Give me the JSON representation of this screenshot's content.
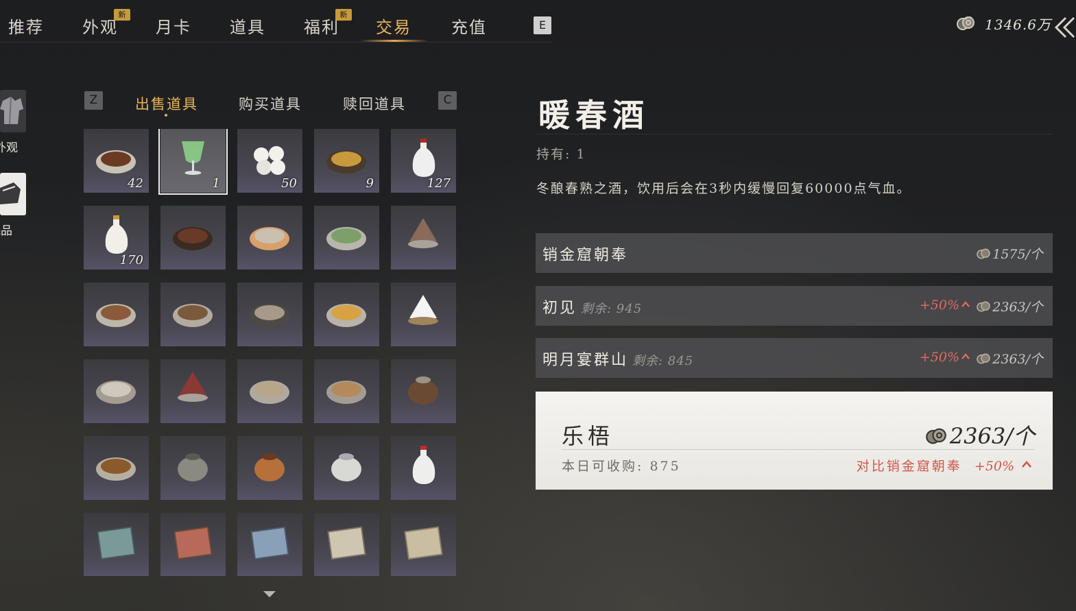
{
  "nav": {
    "tabs": [
      {
        "label": "推荐",
        "badge": ""
      },
      {
        "label": "外观",
        "badge": "新"
      },
      {
        "label": "月卡",
        "badge": ""
      },
      {
        "label": "道具",
        "badge": ""
      },
      {
        "label": "福利",
        "badge": "新"
      },
      {
        "label": "交易",
        "badge": ""
      },
      {
        "label": "充值",
        "badge": ""
      }
    ],
    "active_tab": "交易",
    "key_hint": "E",
    "currency": "1346.6万",
    "accent_color": "#e7b45a"
  },
  "rail": {
    "items": [
      {
        "label": "外观",
        "icon": "robe-icon"
      },
      {
        "label": "耗品",
        "icon": "consumable-icon"
      }
    ]
  },
  "subtabs": {
    "prev_key": "Z",
    "next_key": "C",
    "items": [
      "出售道具",
      "购买道具",
      "赎回道具"
    ],
    "active": "出售道具"
  },
  "grid": {
    "items": [
      {
        "icon": "braised-meat-bowl-icon",
        "count": "42"
      },
      {
        "icon": "green-wine-glass-icon",
        "count": "1"
      },
      {
        "icon": "steamed-buns-icon",
        "count": "50"
      },
      {
        "icon": "pastry-plate-icon",
        "count": "9"
      },
      {
        "icon": "white-wine-bottle-icon",
        "count": "127"
      },
      {
        "icon": "gourd-flask-icon",
        "count": "170"
      },
      {
        "icon": "roast-meat-icon",
        "count": ""
      },
      {
        "icon": "dish-plate-icon",
        "count": ""
      },
      {
        "icon": "cucumber-plate-icon",
        "count": ""
      },
      {
        "icon": "sliced-meat-plate-icon",
        "count": ""
      },
      {
        "icon": "fish-plate-icon",
        "count": ""
      },
      {
        "icon": "stew-bowl-icon",
        "count": ""
      },
      {
        "icon": "tofu-bowl-icon",
        "count": ""
      },
      {
        "icon": "soup-bowl-icon",
        "count": ""
      },
      {
        "icon": "shaved-ice-icon",
        "count": ""
      },
      {
        "icon": "noodle-bowl-icon",
        "count": ""
      },
      {
        "icon": "sliced-beef-plate-icon",
        "count": ""
      },
      {
        "icon": "fish-dish-icon",
        "count": ""
      },
      {
        "icon": "dumpling-plate-icon",
        "count": ""
      },
      {
        "icon": "clay-pot-icon",
        "count": ""
      },
      {
        "icon": "fried-noodles-icon",
        "count": ""
      },
      {
        "icon": "hot-pot-icon",
        "count": ""
      },
      {
        "icon": "leather-flask-icon",
        "count": ""
      },
      {
        "icon": "porcelain-jar-icon",
        "count": ""
      },
      {
        "icon": "red-seal-vase-icon",
        "count": ""
      },
      {
        "icon": "landscape-scroll-icon",
        "count": ""
      },
      {
        "icon": "red-scroll-icon",
        "count": ""
      },
      {
        "icon": "blue-scroll-icon",
        "count": ""
      },
      {
        "icon": "calligraphy-paper-icon",
        "count": ""
      },
      {
        "icon": "old-letter-icon",
        "count": ""
      }
    ],
    "selected_index": 1
  },
  "detail": {
    "title": "暖春酒",
    "owned": "持有: 1",
    "description": "冬酿春熟之酒，饮用后会在3秒内缓慢回复60000点气血。"
  },
  "offers": [
    {
      "name": "销金窟朝奉",
      "remaining": "",
      "bonus": "",
      "price": "1575/个"
    },
    {
      "name": "初见",
      "remaining": "剩余: 945",
      "bonus": "+50%",
      "price": "2363/个"
    },
    {
      "name": "明月宴群山",
      "remaining": "剩余: 845",
      "bonus": "+50%",
      "price": "2363/个"
    }
  ],
  "best_offer": {
    "name": "乐梧",
    "price": "2363/个",
    "quota": "本日可收购: 875",
    "compare": "对比销金窟朝奉",
    "bonus": "+50%",
    "bonus_color": "#d2574c"
  }
}
